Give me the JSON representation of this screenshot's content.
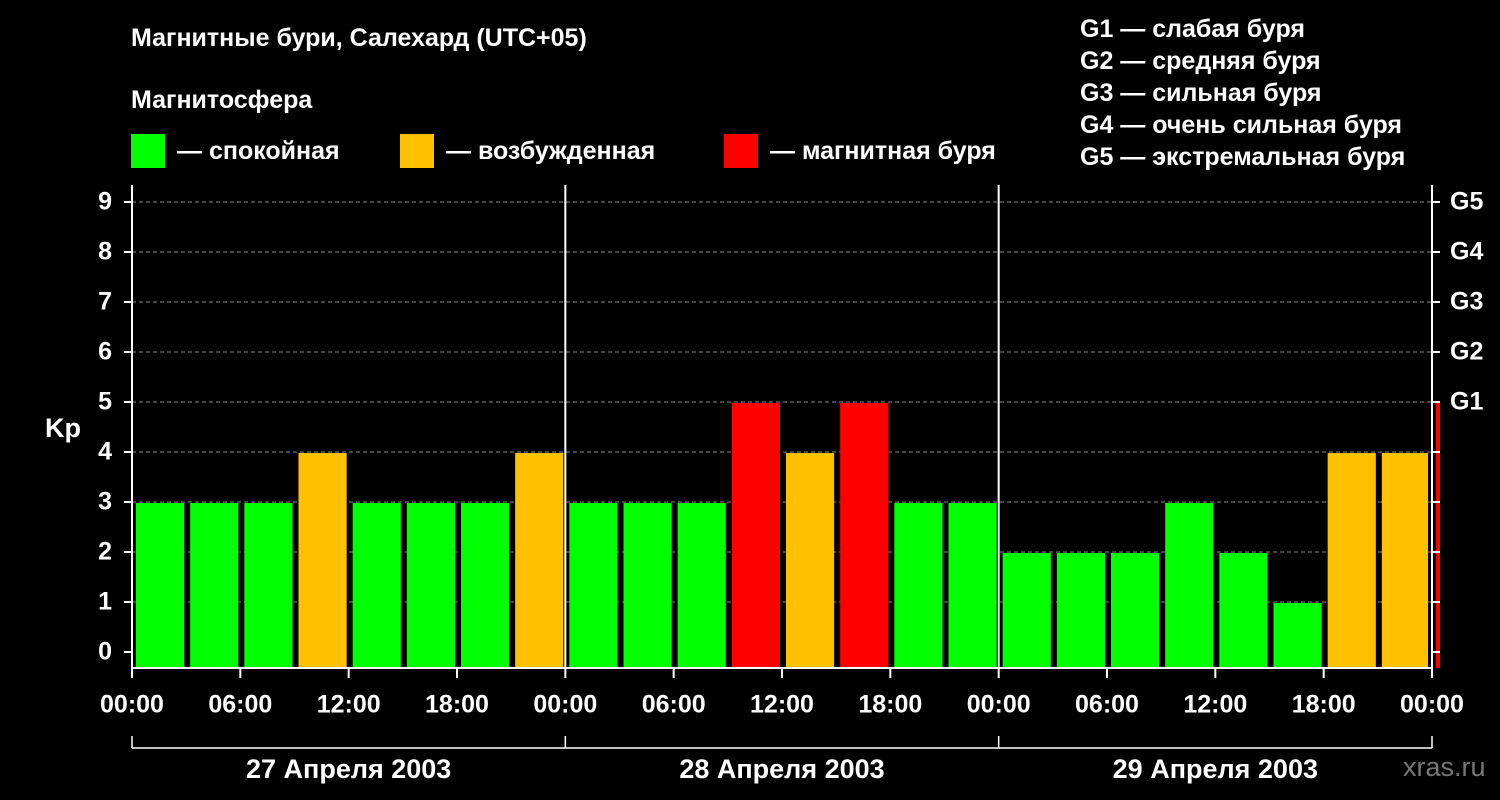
{
  "title": "Магнитные бури, Салехард (UTC+05)",
  "legend": {
    "heading": "Магнитосфера",
    "items": [
      {
        "label": "— спокойная",
        "color": "#00ff00"
      },
      {
        "label": "— возбужденная",
        "color": "#ffc000"
      },
      {
        "label": "— магнитная буря",
        "color": "#ff0000"
      }
    ]
  },
  "storm_scale": [
    "G1 — слабая буря",
    "G2 — средняя буря",
    "G3 — сильная буря",
    "G4 — очень сильная буря",
    "G5 — экстремальная буря"
  ],
  "watermark": "xras.ru",
  "chart_data": {
    "type": "bar",
    "ylabel": "Kp",
    "ylim": [
      0,
      9
    ],
    "y_ticks": [
      0,
      1,
      2,
      3,
      4,
      5,
      6,
      7,
      8,
      9
    ],
    "right_ticks": [
      {
        "value": 5,
        "label": "G1"
      },
      {
        "value": 6,
        "label": "G2"
      },
      {
        "value": 7,
        "label": "G3"
      },
      {
        "value": 8,
        "label": "G4"
      },
      {
        "value": 9,
        "label": "G5"
      }
    ],
    "x_tick_labels": [
      "00:00",
      "06:00",
      "12:00",
      "18:00",
      "00:00",
      "06:00",
      "12:00",
      "18:00",
      "00:00",
      "06:00",
      "12:00",
      "18:00",
      "00:00"
    ],
    "days": [
      "27 Апреля 2003",
      "28 Апреля 2003",
      "29 Апреля 2003"
    ],
    "interval_hours": 3,
    "values": [
      3,
      3,
      3,
      4,
      3,
      3,
      3,
      4,
      3,
      3,
      3,
      5,
      4,
      5,
      3,
      3,
      2,
      2,
      2,
      3,
      2,
      1,
      4,
      4,
      5
    ],
    "colors": {
      "quiet": "#00ff00",
      "active": "#ffc000",
      "storm": "#ff0000"
    },
    "grid": "dashed horizontal at each Kp level",
    "legend_position": "top"
  }
}
